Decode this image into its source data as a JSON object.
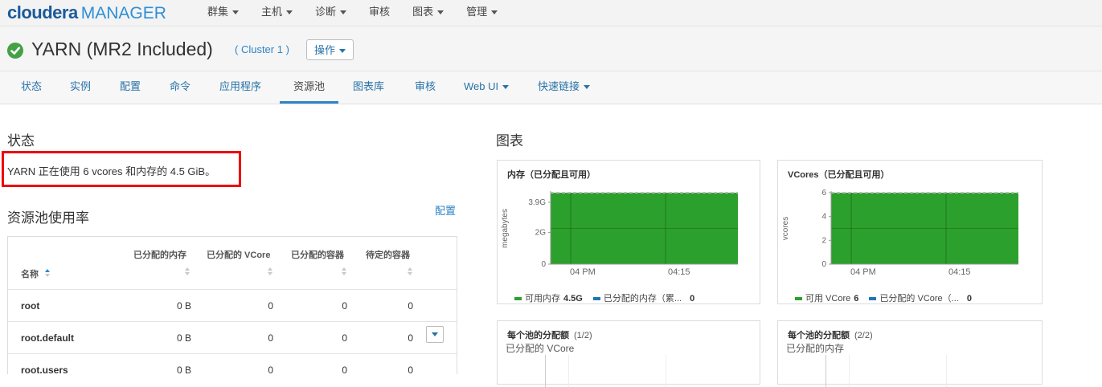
{
  "brand": {
    "name_bold": "cloudera",
    "name_light": "MANAGER"
  },
  "topnav": [
    {
      "label": "群集",
      "caret": true,
      "active": true
    },
    {
      "label": "主机",
      "caret": true
    },
    {
      "label": "诊断",
      "caret": true
    },
    {
      "label": "审核",
      "caret": false
    },
    {
      "label": "图表",
      "caret": true
    },
    {
      "label": "管理",
      "caret": true
    }
  ],
  "service": {
    "title": "YARN (MR2 Included)",
    "cluster": "( Cluster 1 )",
    "actions_label": "操作"
  },
  "tabs": [
    {
      "label": "状态"
    },
    {
      "label": "实例"
    },
    {
      "label": "配置"
    },
    {
      "label": "命令"
    },
    {
      "label": "应用程序"
    },
    {
      "label": "资源池",
      "active": true
    },
    {
      "label": "图表库"
    },
    {
      "label": "审核"
    },
    {
      "label": "Web UI",
      "caret": true
    },
    {
      "label": "快速链接",
      "caret": true
    }
  ],
  "status": {
    "heading": "状态",
    "text": "YARN 正在使用 6 vcores 和内存的 4.5 GiB。"
  },
  "pool_usage": {
    "heading": "资源池使用率",
    "config_link": "配置",
    "columns": {
      "name": "名称",
      "mem": "已分配的内存",
      "vcore": "已分配的 VCore",
      "containers": "已分配的容器",
      "pending": "待定的容器"
    },
    "rows": [
      {
        "name": "root",
        "mem": "0 B",
        "vcore": "0",
        "containers": "0",
        "pending": "0"
      },
      {
        "name": "root.default",
        "mem": "0 B",
        "vcore": "0",
        "containers": "0",
        "pending": "0"
      },
      {
        "name": "root.users",
        "mem": "0 B",
        "vcore": "0",
        "containers": "0",
        "pending": "0"
      }
    ]
  },
  "charts_heading": "图表",
  "chart_data": [
    {
      "type": "area",
      "title": "内存（已分配且可用）",
      "ylabel": "megabytes",
      "yticks": [
        "0",
        "2G",
        "3.9G"
      ],
      "ylim": [
        0,
        4.5
      ],
      "xticks": [
        "04 PM",
        "04:15"
      ],
      "series": [
        {
          "name": "可用内存",
          "value_label": "4.5G",
          "color": "#2ca02c",
          "values": [
            4.5,
            4.5
          ]
        },
        {
          "name": "已分配的内存（累...",
          "value_label": "0",
          "color": "#1f77b4",
          "values": [
            0,
            0
          ]
        }
      ]
    },
    {
      "type": "area",
      "title": "VCores（已分配且可用）",
      "ylabel": "vcores",
      "yticks": [
        "0",
        "2",
        "4",
        "6"
      ],
      "ylim": [
        0,
        6
      ],
      "xticks": [
        "04 PM",
        "04:15"
      ],
      "series": [
        {
          "name": "可用 VCore",
          "value_label": "6",
          "color": "#2ca02c",
          "values": [
            6,
            6
          ]
        },
        {
          "name": "已分配的 VCore（...",
          "value_label": "0",
          "color": "#1f77b4",
          "values": [
            0,
            0
          ]
        }
      ]
    }
  ],
  "alloc_panels": [
    {
      "title": "每个池的分配额",
      "count": "(1/2)",
      "subtitle": "已分配的 VCore"
    },
    {
      "title": "每个池的分配额",
      "count": "(2/2)",
      "subtitle": "已分配的内存"
    }
  ]
}
